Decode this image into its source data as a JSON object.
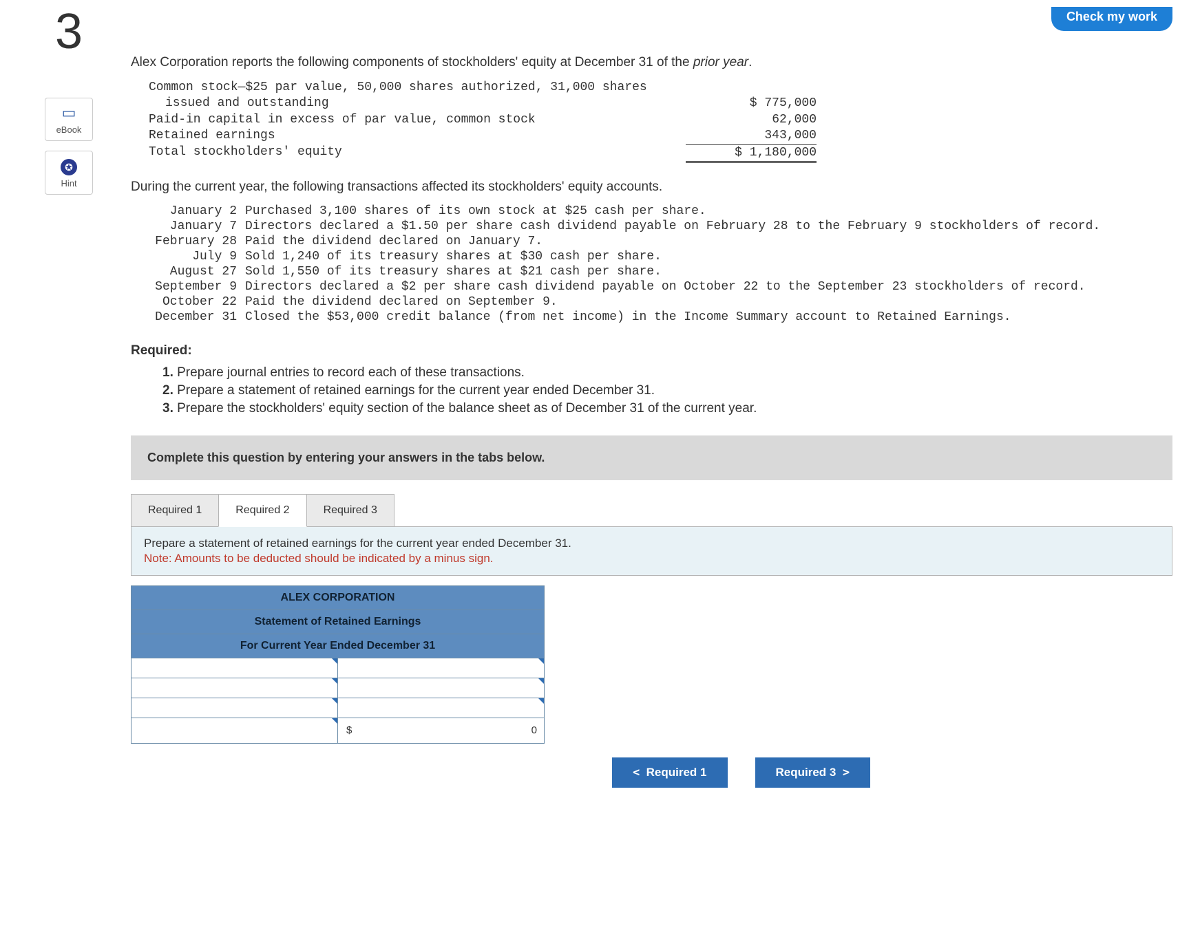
{
  "header": {
    "check_work": "Check my work"
  },
  "question_number": "3",
  "tools": {
    "ebook": "eBook",
    "hint": "Hint",
    "hint_glyph": "✪"
  },
  "intro": {
    "text_before": "Alex Corporation reports the following components of stockholders' equity at December 31 of the ",
    "prior_year": "prior year",
    "text_after": "."
  },
  "equity": {
    "rows": [
      {
        "label": "Common stock—$25 par value, 50,000 shares authorized, 31,000 shares",
        "value": ""
      },
      {
        "label": "issued and outstanding",
        "value": "$ 775,000",
        "indent": true
      },
      {
        "label": "Paid-in capital in excess of par value, common stock",
        "value": "62,000"
      },
      {
        "label": "Retained earnings",
        "value": "343,000"
      },
      {
        "label": "Total stockholders' equity",
        "value": "$ 1,180,000",
        "total": true
      }
    ]
  },
  "mid_text": "During the current year, the following transactions affected its stockholders' equity accounts.",
  "transactions": [
    {
      "date": "January 2",
      "desc": "Purchased 3,100 shares of its own stock at $25 cash per share."
    },
    {
      "date": "January 7",
      "desc": "Directors declared a $1.50 per share cash dividend payable on February 28 to the February 9 stockholders of record."
    },
    {
      "date": "February 28",
      "desc": "Paid the dividend declared on January 7."
    },
    {
      "date": "July 9",
      "desc": "Sold 1,240 of its treasury shares at $30 cash per share."
    },
    {
      "date": "August 27",
      "desc": "Sold 1,550 of its treasury shares at $21 cash per share."
    },
    {
      "date": "September 9",
      "desc": "Directors declared a $2 per share cash dividend payable on October 22 to the September 23 stockholders of record."
    },
    {
      "date": "October 22",
      "desc": "Paid the dividend declared on September 9."
    },
    {
      "date": "December 31",
      "desc": "Closed the $53,000 credit balance (from net income) in the Income Summary account to Retained Earnings."
    }
  ],
  "required_header": "Required:",
  "required_items": [
    "Prepare journal entries to record each of these transactions.",
    "Prepare a statement of retained earnings for the current year ended December 31.",
    "Prepare the stockholders' equity section of the balance sheet as of December 31 of the current year."
  ],
  "instruction_bar": "Complete this question by entering your answers in the tabs below.",
  "tabs": {
    "t1": "Required 1",
    "t2": "Required 2",
    "t3": "Required 3"
  },
  "panel": {
    "line1": "Prepare a statement of retained earnings for the current year ended December 31.",
    "line2": "Note: Amounts to be deducted should be indicated by a minus sign."
  },
  "worksheet": {
    "title1": "ALEX CORPORATION",
    "title2": "Statement of Retained Earnings",
    "title3": "For Current Year Ended December 31",
    "total_symbol": "$",
    "total_value": "0"
  },
  "nav": {
    "prev": "Required 1",
    "next": "Required 3"
  }
}
